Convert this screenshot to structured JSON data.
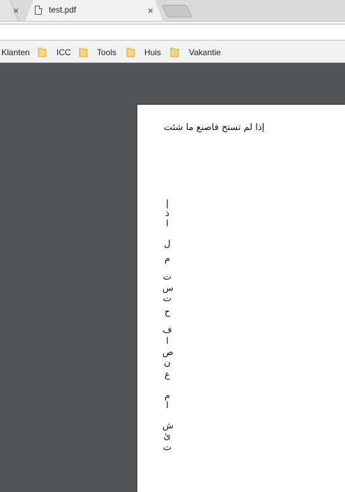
{
  "tabs": {
    "prev_close": "×",
    "active_title": "test.pdf",
    "active_close": "×"
  },
  "bookmarks": [
    {
      "label": "Klanten"
    },
    {
      "label": "ICC"
    },
    {
      "label": "Tools"
    },
    {
      "label": "Huis"
    },
    {
      "label": "Vakantie"
    }
  ],
  "pdf": {
    "sentence": "إذا لم تستح فاصنع ما شئت",
    "vertical_letters": [
      "إ",
      "ذ",
      "ا",
      "ل",
      "م",
      "ت",
      "س",
      "ت",
      "ح",
      "ف",
      "ا",
      "ص",
      "ن",
      "ع",
      "م",
      "ا",
      "ش",
      "ئ",
      "ت"
    ]
  },
  "colors": {
    "viewer_bg": "#525659",
    "folder": "#f7d774",
    "page": "#ffffff"
  }
}
